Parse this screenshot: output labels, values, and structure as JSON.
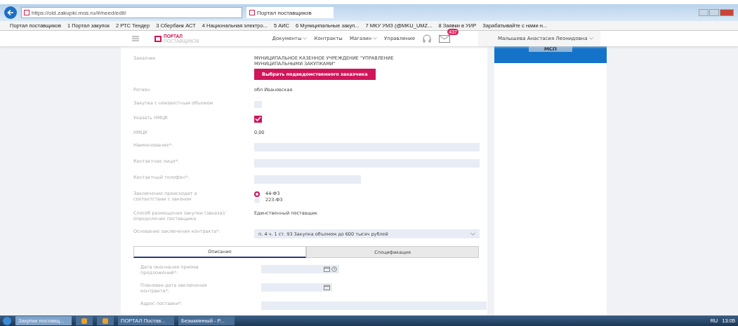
{
  "browser": {
    "url": "https://old.zakupki.mos.ru/#/need/edit/",
    "tab": "Портал поставщиков",
    "bookmarks": [
      "Портал поставщиков",
      "1 Портал закупок",
      "2 РТС Тендер",
      "3 Сбербанк АСТ",
      "4 Национальная электро...",
      "5 АИС",
      "6 Муниципальные закуп...",
      "7 МКУ УМЗ (@MKU_UMZ...",
      "8 Заявки в УИР",
      "Зарабатывайте с нами н..."
    ]
  },
  "header": {
    "logo": "ПОРТАЛ",
    "logo_sub": "ПОСТАВЩИКОВ",
    "nav": [
      {
        "label": "Документы",
        "dropdown": true
      },
      {
        "label": "Контракты",
        "dropdown": false
      },
      {
        "label": "Магазин",
        "dropdown": true
      },
      {
        "label": "Управление",
        "dropdown": false
      }
    ],
    "badge": "437",
    "user": "Малышева Анастасия Леонидовна"
  },
  "form": {
    "rows": [
      {
        "kind": "text",
        "label": "Заказчик",
        "value": "МУНИЦИПАЛЬНОЕ КАЗЕННОЕ УЧРЕЖДЕНИЕ \"УПРАВЛЕНИЕ МУНИЦИПАЛЬНЫМИ ЗАКУПКАМИ\"",
        "button": "Выбрать подведомственного заказчика"
      },
      {
        "kind": "text",
        "label": "Регион",
        "value": "обл Ивановская"
      },
      {
        "kind": "checkbox",
        "label": "Закупка с неизвестным объемом",
        "checked": false
      },
      {
        "kind": "checkbox",
        "label": "Указать НМЦК",
        "checked": true
      },
      {
        "kind": "text",
        "label": "НМЦК",
        "value": "0,00"
      },
      {
        "kind": "input",
        "label": "Наименование*:"
      },
      {
        "kind": "input",
        "label": "Контактное лицо*:"
      },
      {
        "kind": "short-input",
        "label": "Контактный телефон*:"
      },
      {
        "kind": "radio",
        "label": "Заключение происходит в соответствии с законом",
        "options": [
          {
            "label": "44-ФЗ",
            "selected": true
          },
          {
            "label": "223-ФЗ",
            "selected": false
          }
        ]
      },
      {
        "kind": "text",
        "label": "Способ размещения закупки (заказа)/определение поставщика",
        "value": "Единственный поставщик"
      },
      {
        "kind": "select",
        "label": "Основание заключения контракта*:",
        "value": "п. 4 ч. 1 ст. 93 Закупка объемом до 600 тысяч рублей"
      }
    ],
    "tabs": [
      {
        "label": "Описание",
        "selected": true
      },
      {
        "label": "Спецификация",
        "selected": false
      }
    ],
    "subrows": [
      {
        "kind": "datetime",
        "label": "Дата окончания приема предложений*:"
      },
      {
        "kind": "date",
        "label": "Плановая дата заключения контракта*:"
      },
      {
        "kind": "input",
        "label": "Адрес поставки*:"
      }
    ]
  },
  "sidebar": {
    "banner": "МСП"
  },
  "taskbar": {
    "items": [
      {
        "kind": "window",
        "label": "Закупки поставщ...",
        "active": true
      },
      {
        "kind": "app",
        "active": false
      },
      {
        "kind": "app",
        "active": false
      },
      {
        "kind": "window",
        "label": "ПОРТАЛ Постав...",
        "active": false
      },
      {
        "kind": "window",
        "label": "Безымянный - P...",
        "active": false
      }
    ],
    "lang": "RU",
    "time": "13:05"
  }
}
